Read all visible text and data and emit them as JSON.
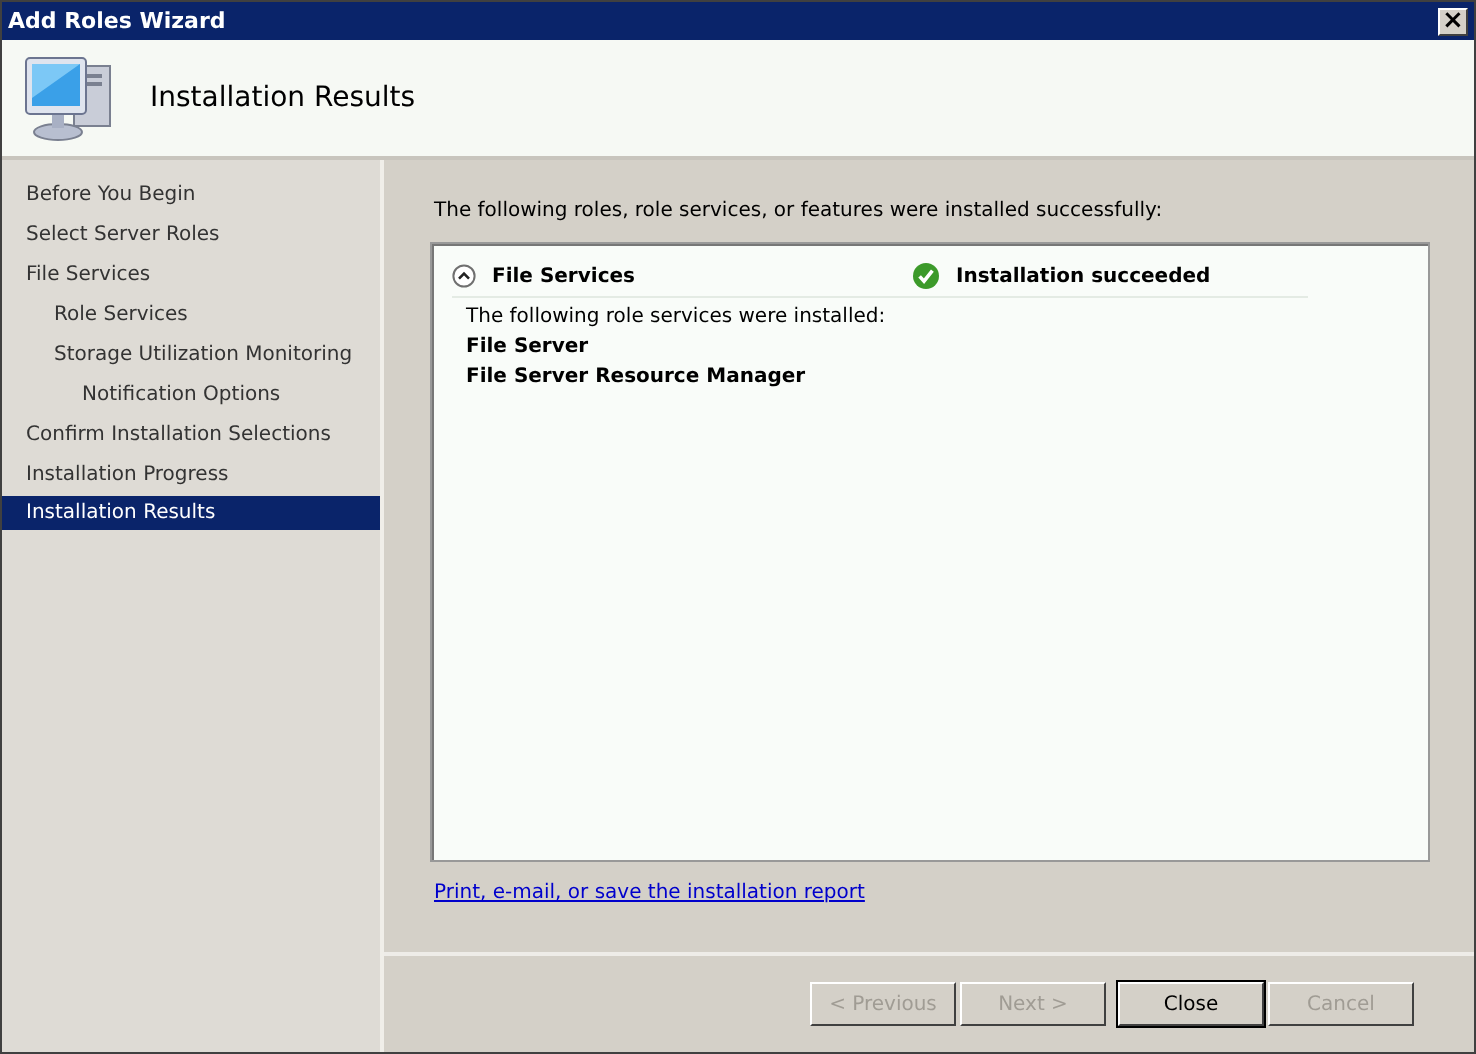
{
  "window": {
    "title": "Add Roles Wizard",
    "close_glyph": "×"
  },
  "header": {
    "title": "Installation Results"
  },
  "sidebar": {
    "items": [
      {
        "label": "Before You Begin",
        "selected": false
      },
      {
        "label": "Select Server Roles",
        "selected": false
      },
      {
        "label": "File Services",
        "selected": false,
        "children": [
          {
            "label": "Role Services",
            "selected": false
          },
          {
            "label": "Storage Utilization Monitoring",
            "selected": false,
            "children": [
              {
                "label": "Notification Options",
                "selected": false
              }
            ]
          }
        ]
      },
      {
        "label": "Confirm Installation Selections",
        "selected": false
      },
      {
        "label": "Installation Progress",
        "selected": false
      },
      {
        "label": "Installation Results",
        "selected": true
      }
    ]
  },
  "intro": "The following roles, role services, or features were installed successfully:",
  "results": [
    {
      "name": "File Services",
      "expanded": true,
      "status": "Installation succeeded",
      "note": "The following role services were installed:",
      "items": [
        "File Server",
        "File Server Resource Manager"
      ]
    }
  ],
  "report_link": "Print, e-mail, or save the installation report",
  "buttons": [
    {
      "label": "< Previous",
      "disabled": true,
      "default": false
    },
    {
      "label": "Next >",
      "disabled": true,
      "default": false
    },
    {
      "label": "Close",
      "disabled": false,
      "default": true
    },
    {
      "label": "Cancel",
      "disabled": true,
      "default": false
    }
  ]
}
